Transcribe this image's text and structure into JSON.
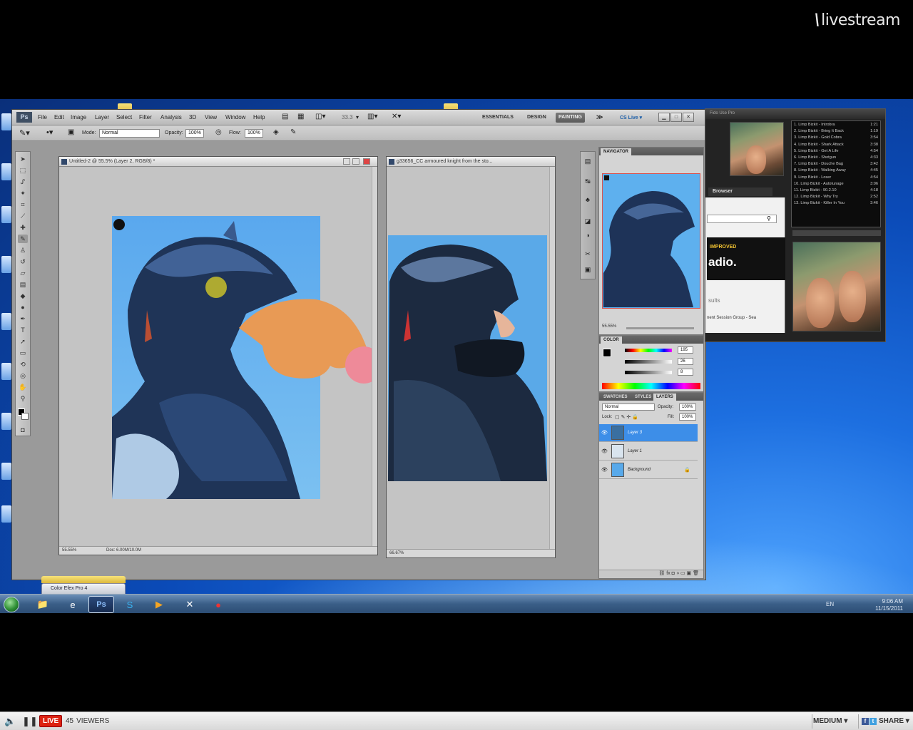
{
  "livestream": {
    "logo_text": "livestream",
    "logo_mark": "\\",
    "live_label": "LIVE",
    "viewer_count": "45",
    "viewers_label": "VIEWERS",
    "quality_label": "MEDIUM ▾",
    "share_label": "SHARE ▾"
  },
  "photoshop": {
    "menu": [
      "File",
      "Edit",
      "Image",
      "Layer",
      "Select",
      "Filter",
      "Analysis",
      "3D",
      "View",
      "Window",
      "Help"
    ],
    "zoom_field": "33.3",
    "workspaces": [
      "ESSENTIALS",
      "DESIGN",
      "PAINTING"
    ],
    "active_workspace": "PAINTING",
    "cs_live": "CS Live ▾",
    "options": {
      "mode_label": "Mode:",
      "mode_value": "Normal",
      "opacity_label": "Opacity:",
      "opacity_value": "100%",
      "flow_label": "Flow:",
      "flow_value": "100%"
    },
    "doc1": {
      "title": "Untitled-2 @ 55.5% (Layer 2, RGB/8) *",
      "zoom": "55.55%",
      "doc_info": "Doc: 6.00M/10.0M"
    },
    "doc2": {
      "title": "g33656_CC armoured knight from the sto...",
      "zoom": "66.67%"
    },
    "navigator": {
      "tab": "NAVIGATOR",
      "zoom": "55.55%"
    },
    "color_panel": {
      "tab": "COLOR",
      "r_value": "195",
      "g_value": "26",
      "b_value": "8"
    },
    "layers_panel": {
      "tabs": [
        "SWATCHES",
        "STYLES",
        "LAYERS"
      ],
      "active_tab": "LAYERS",
      "blend_mode": "Normal",
      "opacity_label": "Opacity:",
      "opacity_value": "100%",
      "lock_label": "Lock:",
      "fill_label": "Fill:",
      "fill_value": "100%",
      "layers": [
        {
          "name": "Layer 3",
          "selected": true,
          "locked": false
        },
        {
          "name": "Layer 1",
          "selected": false,
          "locked": false
        },
        {
          "name": "Background",
          "selected": false,
          "locked": true
        }
      ]
    }
  },
  "player": {
    "title": "Fido   Use Pro",
    "browser_tab": "Browser",
    "banner_top": "IMPROVED",
    "banner_main": "adio.",
    "results_label": "sults",
    "now_playing_line": "nent Session Group - Sea",
    "tracks": [
      {
        "title": "1. Limp Bizkit - Introbra",
        "time": "1:21"
      },
      {
        "title": "2. Limp Bizkit - Bring It Back",
        "time": "1:19"
      },
      {
        "title": "3. Limp Bizkit - Gold Cobra",
        "time": "3:54"
      },
      {
        "title": "4. Limp Bizkit - Shark Attack",
        "time": "3:38"
      },
      {
        "title": "5. Limp Bizkit - Get A Life",
        "time": "4:54"
      },
      {
        "title": "6. Limp Bizkit - Shotgun",
        "time": "4:33"
      },
      {
        "title": "7. Limp Bizkit - Douche Bag",
        "time": "3:42"
      },
      {
        "title": "8. Limp Bizkit - Walking Away",
        "time": "4:45"
      },
      {
        "title": "9. Limp Bizkit - Loser",
        "time": "4:54"
      },
      {
        "title": "10. Limp Bizkit - Autotunage",
        "time": "3:06"
      },
      {
        "title": "11. Limp Bizkit - 90.2.10",
        "time": "4:18"
      },
      {
        "title": "12. Limp Bizkit - Why Try",
        "time": "2:52"
      },
      {
        "title": "13. Limp Bizkit - Killer In You",
        "time": "3:46"
      }
    ]
  },
  "taskbar": {
    "color_efex_tab": "Color Efex Pro 4",
    "lang": "EN",
    "time": "9:06 AM",
    "date": "11/15/2011"
  }
}
